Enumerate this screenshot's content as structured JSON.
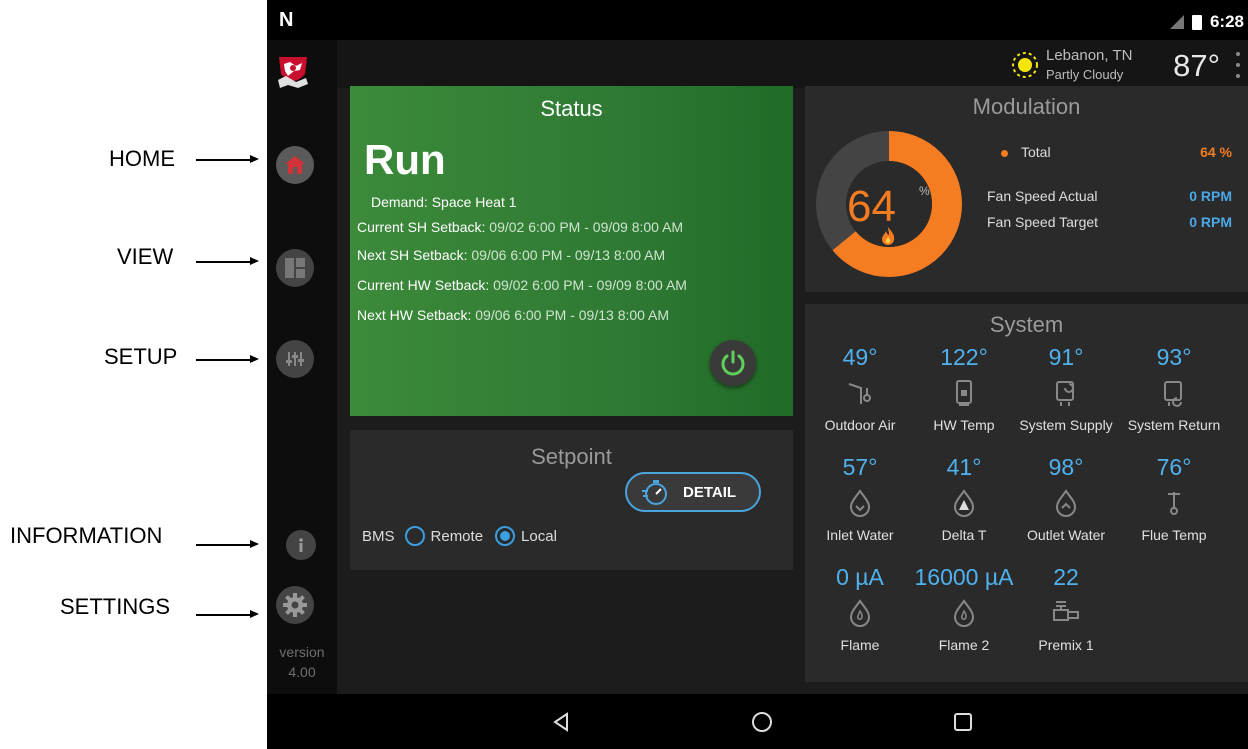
{
  "annotations": {
    "home": "HOME",
    "view": "VIEW",
    "setup": "SETUP",
    "information": "INFORMATION",
    "settings": "SETTINGS"
  },
  "status_bar": {
    "time": "6:28",
    "left_logo": "N"
  },
  "sidebar": {
    "version_label": "version",
    "version_number": "4.00"
  },
  "topbar": {
    "weather_city": "Lebanon, TN",
    "weather_condition": "Partly Cloudy",
    "temperature": "87°"
  },
  "status": {
    "title": "Status",
    "state": "Run",
    "demand": "Demand: Space Heat 1",
    "current_sh_label": "Current SH Setback:",
    "current_sh_value": "09/02 6:00 PM - 09/09 8:00 AM",
    "next_sh_label": "Next SH Setback:",
    "next_sh_value": "09/06 6:00 PM - 09/13 8:00 AM",
    "current_hw_label": "Current HW Setback:",
    "current_hw_value": "09/02 6:00 PM - 09/09 8:00 AM",
    "next_hw_label": "Next HW Setback:",
    "next_hw_value": "09/06 6:00 PM - 09/13 8:00 AM"
  },
  "setpoint": {
    "title": "Setpoint",
    "detail_button": "DETAIL",
    "bms_label": "BMS",
    "remote_label": "Remote",
    "local_label": "Local",
    "selected": "Local"
  },
  "modulation": {
    "title": "Modulation",
    "gauge_value": "64",
    "gauge_unit": "%",
    "gauge_fraction": 0.64,
    "total_label": "Total",
    "total_value": "64 %",
    "fan_actual_label": "Fan Speed Actual",
    "fan_actual_value": "0 RPM",
    "fan_target_label": "Fan Speed Target",
    "fan_target_value": "0 RPM",
    "colors": {
      "fill": "#f57c20",
      "track": "#444444",
      "rpm": "#4aa8e8"
    }
  },
  "system": {
    "title": "System",
    "items": [
      {
        "value": "49°",
        "label": "Outdoor Air",
        "icon": "outdoor-air-icon"
      },
      {
        "value": "122°",
        "label": "HW Temp",
        "icon": "hw-tank-icon"
      },
      {
        "value": "91°",
        "label": "System Supply",
        "icon": "system-supply-icon"
      },
      {
        "value": "93°",
        "label": "System Return",
        "icon": "system-return-icon"
      },
      {
        "value": "57°",
        "label": "Inlet Water",
        "icon": "inlet-water-icon"
      },
      {
        "value": "41°",
        "label": "Delta T",
        "icon": "delta-t-icon"
      },
      {
        "value": "98°",
        "label": "Outlet Water",
        "icon": "outlet-water-icon"
      },
      {
        "value": "76°",
        "label": "Flue Temp",
        "icon": "flue-temp-icon"
      },
      {
        "value": "0 µA",
        "label": "Flame",
        "icon": "flame-icon"
      },
      {
        "value": "16000 µA",
        "label": "Flame 2",
        "icon": "flame-2-icon"
      },
      {
        "value": "22",
        "label": "Premix 1",
        "icon": "premix-icon"
      }
    ]
  }
}
